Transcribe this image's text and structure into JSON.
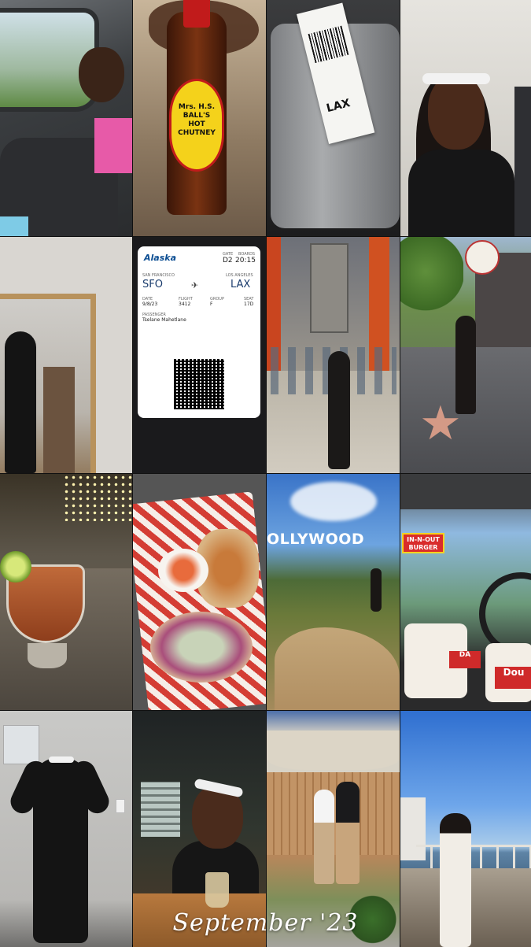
{
  "collage": {
    "caption": "September '23",
    "tiles": [
      {
        "id": 1,
        "subject": "car selfie"
      },
      {
        "id": 2,
        "subject": "hot chutney bottle",
        "label": "Mrs. H.S. BALL'S\nHOT\nCHUTNEY"
      },
      {
        "id": 3,
        "subject": "luggage tag",
        "code": "LAX"
      },
      {
        "id": 4,
        "subject": "smiling selfie"
      },
      {
        "id": 5,
        "subject": "mirror selfie"
      },
      {
        "id": 6,
        "subject": "boarding pass"
      },
      {
        "id": 7,
        "subject": "Chinese theatre"
      },
      {
        "id": 8,
        "subject": "walk of fame"
      },
      {
        "id": 9,
        "subject": "cocktail"
      },
      {
        "id": 10,
        "subject": "tacos"
      },
      {
        "id": 11,
        "subject": "hollywood sign",
        "sign_text": "OLLYWOOD"
      },
      {
        "id": 12,
        "subject": "in-n-out burgers",
        "sign_text": "IN-N-OUT\nBURGER",
        "bag_text_1": "DA",
        "bag_text_2": "Dou"
      },
      {
        "id": 13,
        "subject": "black outfit pose"
      },
      {
        "id": 14,
        "subject": "cafe smile"
      },
      {
        "id": 15,
        "subject": "couple photo"
      },
      {
        "id": 16,
        "subject": "ferry view"
      }
    ]
  },
  "boarding_pass": {
    "airline": "Alaska",
    "gate_label": "GATE",
    "gate": "D2",
    "boards_label": "BOARDS",
    "boards": "20:15",
    "from_city": "SAN FRANCISCO",
    "from_code": "SFO",
    "to_city": "LOS ANGELES",
    "to_code": "LAX",
    "date_label": "DATE",
    "date": "9/8/23",
    "flight_label": "FLIGHT",
    "flight": "3412",
    "group_label": "GROUP",
    "group": "F",
    "seat_label": "SEAT",
    "seat": "17D",
    "passenger_label": "PASSENGER",
    "passenger": "Tselane Mahetlane"
  },
  "colors": {
    "accent": "#0b4d92",
    "background": "#000000"
  }
}
